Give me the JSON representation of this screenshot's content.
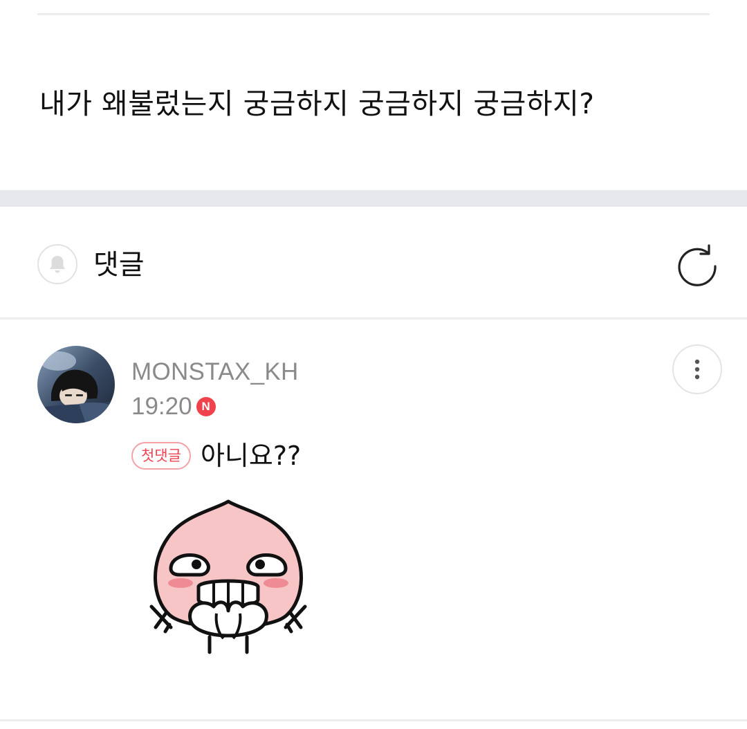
{
  "post": {
    "body_text": "내가 왜불렀는지 궁금하지 궁금하지 궁금하지?"
  },
  "comments_header": {
    "title": "댓글",
    "bell_icon": "bell-icon",
    "refresh_icon": "refresh-icon"
  },
  "comment": {
    "author": "MONSTAX_KH",
    "time": "19:20",
    "new_badge": "N",
    "first_comment_badge": "첫댓글",
    "text": "아니요??",
    "more_icon": "more-vertical-icon",
    "sticker": "peach-character-sticker"
  },
  "colors": {
    "badge_red": "#f0424d",
    "muted_text": "#8a8a8a",
    "section_gap": "#e6e7ea"
  }
}
